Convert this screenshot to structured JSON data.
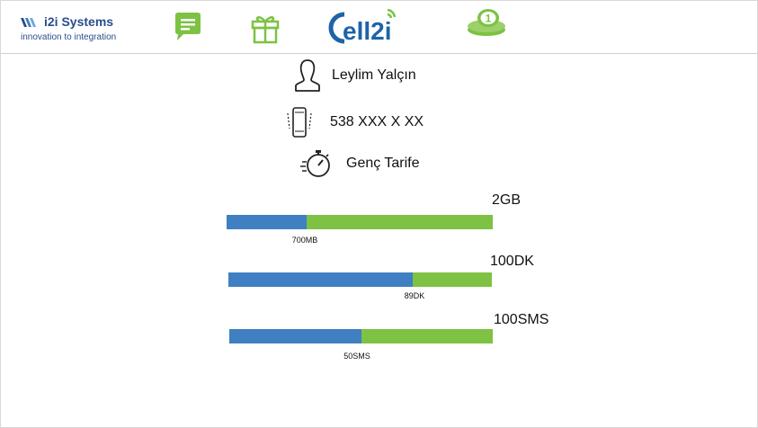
{
  "header": {
    "brand_name": "i2i Systems",
    "brand_tagline": "innovation to integration",
    "logo_text": "ell2i",
    "coins_badge": "1"
  },
  "profile": {
    "name": "Leylim Yalçın",
    "phone": "538 XXX X XX",
    "tariff": "Genç Tarife"
  },
  "usage": [
    {
      "limit": "2GB",
      "used_label": "700MB",
      "used_fraction": 0.3
    },
    {
      "limit": "100DK",
      "used_label": "89DK",
      "used_fraction": 0.7
    },
    {
      "limit": "100SMS",
      "used_label": "50SMS",
      "used_fraction": 0.5
    }
  ],
  "colors": {
    "used": "#3f7fc2",
    "remaining": "#7dc242",
    "icon_green": "#7dc242",
    "brand_blue": "#2a4c8d"
  },
  "icons": [
    "chat-icon",
    "gift-icon",
    "cell2i-logo",
    "coins-icon",
    "user-icon",
    "phone-icon",
    "stopwatch-icon"
  ]
}
